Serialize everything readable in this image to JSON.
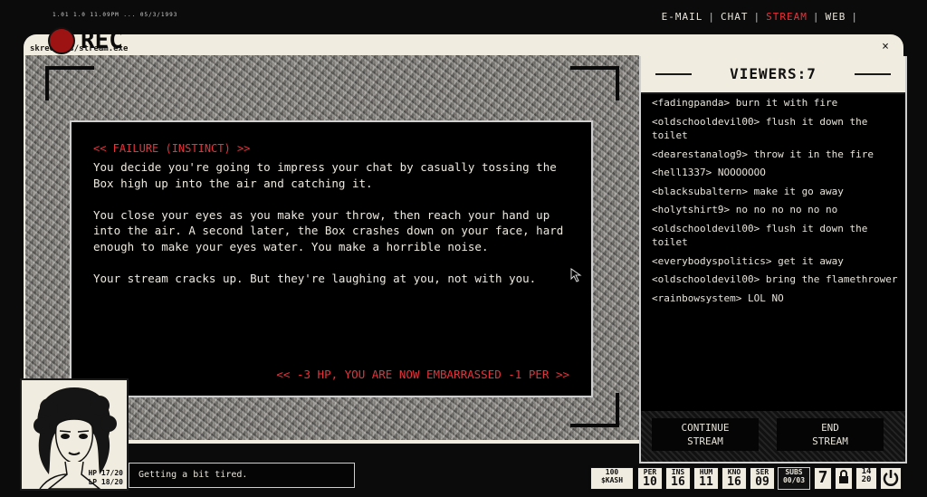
{
  "topbar": {
    "sys_text": "1.01 1.0   11.09PM ... 05/3/1993",
    "nav": [
      {
        "label": "E-MAIL"
      },
      {
        "label": "CHAT"
      },
      {
        "label": "STREAM",
        "active": true
      },
      {
        "label": "WEB"
      }
    ]
  },
  "window": {
    "title": "skreeners/stream.exe",
    "close_glyph": "×"
  },
  "rec_label": "REC",
  "dialog": {
    "heading": "<< FAILURE (INSTINCT) >>",
    "paragraphs": [
      "You decide you're going to impress your chat by casually tossing the Box high up into the air and catching it.",
      "You close your eyes as you make your throw, then reach your hand up into the air. A second later, the Box crashes down on your face, hard enough to make your eyes water. You make a horrible noise.",
      "Your stream cracks up. But they're laughing at you, not with you."
    ],
    "outcome": "<< -3 HP, YOU ARE NOW EMBARRASSED -1 PER >>"
  },
  "chat": {
    "header": "VIEWERS:7",
    "messages": [
      "<fadingpanda> burn it with fire",
      "<oldschooldevil00> flush it down the toilet",
      "<dearestanalog9> throw it in the fire",
      "<hell1337> NOOOOOOO",
      "<blacksubaltern> make it go away",
      "<holytshirt9> no no no no no no",
      "<oldschooldevil00> flush it down the toilet",
      "<everybodyspolitics> get it away",
      "<oldschooldevil00> bring the flamethrower",
      "<rainbowsystem> LOL NO"
    ]
  },
  "buttons": {
    "continue_line1": "CONTINUE",
    "continue_line2": "STREAM",
    "end_line1": "END",
    "end_line2": "STREAM"
  },
  "portrait": {
    "hp": "HP 17/20",
    "lp": "LP 18/20"
  },
  "status_line": "Getting a bit tired.",
  "statbar": {
    "cash_amount": "100",
    "cash_label": "$KASH",
    "stats": [
      {
        "label": "PER",
        "value": "10"
      },
      {
        "label": "INS",
        "value": "16"
      },
      {
        "label": "HUM",
        "value": "11"
      },
      {
        "label": "KNO",
        "value": "16"
      },
      {
        "label": "SER",
        "value": "09"
      }
    ],
    "subs_label": "SUBS",
    "subs_value": "00/03",
    "day": "7",
    "tally_top": "14",
    "tally_bottom": "20"
  },
  "colors": {
    "accent_red": "#e8323a",
    "paper": "#f1ece0",
    "rec_red": "#9d1313"
  }
}
